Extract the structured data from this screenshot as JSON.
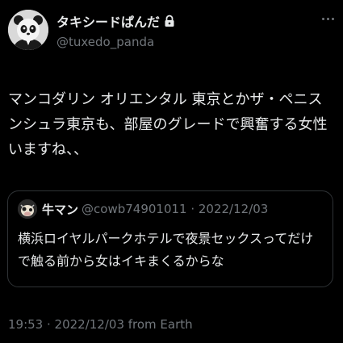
{
  "author": {
    "display_name": "タキシードぱんだ",
    "handle": "@tuxedo_panda",
    "protected_icon": "lock-icon",
    "avatar_icon": "panda-avatar"
  },
  "tweet": {
    "lines": [
      "マンコダリン オリエンタル 東京とかザ・ペニス",
      "ンシュラ東京も、部屋のグレードで興奮する女性",
      "いますね、、"
    ]
  },
  "quote": {
    "display_name": "牛マン",
    "meta": "@cowb74901011 · 2022/12/03",
    "lines": [
      "横浜ロイヤルパークホテルで夜景セックスってだけ",
      "で触る前から女はイキまくるからな"
    ]
  },
  "footer": {
    "timestamp": "19:53 · 2022/12/03 from Earth"
  },
  "colors": {
    "background": "#000000",
    "text_primary": "#e7e9ea",
    "text_secondary": "#71767b",
    "border": "#2f3336"
  }
}
